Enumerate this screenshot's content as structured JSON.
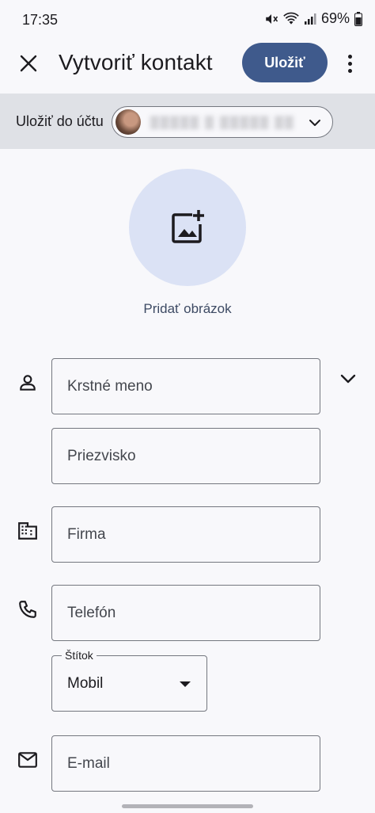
{
  "status_bar": {
    "time": "17:35",
    "battery": "69%",
    "icons": [
      "mute-icon",
      "wifi-icon",
      "signal-icon",
      "battery-icon"
    ]
  },
  "app_bar": {
    "title": "Vytvoriť kontakt",
    "save_label": "Uložiť",
    "icons": [
      "close-icon",
      "more-vert-icon"
    ]
  },
  "account": {
    "label": "Uložiť do účtu",
    "email_blurred": "▒▒▒▒▒ ▒  ▒▒▒▒▒ ▒▒"
  },
  "photo": {
    "label": "Pridať obrázok",
    "icon": "add-photo-icon"
  },
  "fields": {
    "first_name": "Krstné meno",
    "last_name": "Priezvisko",
    "company": "Firma",
    "phone": "Telefón",
    "label_caption": "Štítok",
    "label_value": "Mobil",
    "email": "E-mail"
  },
  "colors": {
    "accent": "#3f5a8c",
    "photo_bg": "#dbe2f5",
    "account_strip": "#dfe1e6",
    "background": "#f8f8fb"
  }
}
